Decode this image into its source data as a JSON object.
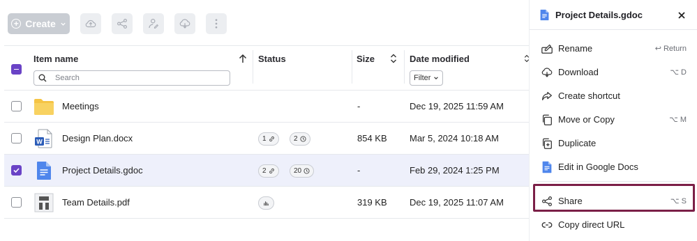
{
  "toolbar": {
    "create_label": "Create",
    "buttons": [
      "upload-icon",
      "share-icon",
      "assign-icon",
      "download-icon",
      "more-icon"
    ]
  },
  "table": {
    "headers": {
      "name": "Item name",
      "status": "Status",
      "size": "Size",
      "date": "Date modified"
    },
    "search_placeholder": "Search",
    "filter_label": "Filter",
    "rows": [
      {
        "name": "Meetings",
        "type": "folder",
        "status": [],
        "size": "-",
        "date": "Dec 19, 2025 11:59 AM",
        "selected": false
      },
      {
        "name": "Design Plan.docx",
        "type": "word",
        "status": [
          {
            "count": "1",
            "icon": "link-icon"
          },
          {
            "count": "2",
            "icon": "clock-icon"
          }
        ],
        "size": "854 KB",
        "date": "Mar 5, 2024 10:18 AM",
        "selected": false
      },
      {
        "name": "Project Details.gdoc",
        "type": "gdoc",
        "status": [
          {
            "count": "2",
            "icon": "link-icon"
          },
          {
            "count": "20",
            "icon": "clock-icon"
          }
        ],
        "size": "-",
        "date": "Feb 29, 2024 1:25 PM",
        "selected": true
      },
      {
        "name": "Team Details.pdf",
        "type": "pdf",
        "status": [
          {
            "count": "",
            "icon": "chart-icon"
          }
        ],
        "size": "319 KB",
        "date": "Dec 19, 2025 11:07 AM",
        "selected": false
      }
    ]
  },
  "panel": {
    "title": "Project Details.gdoc",
    "items": [
      {
        "label": "Rename",
        "shortcut": "↩ Return",
        "icon": "rename-icon"
      },
      {
        "label": "Download",
        "shortcut": "⌥ D",
        "icon": "download-icon"
      },
      {
        "label": "Create shortcut",
        "shortcut": "",
        "icon": "shortcut-icon"
      },
      {
        "label": "Move or Copy",
        "shortcut": "⌥ M",
        "icon": "move-copy-icon"
      },
      {
        "label": "Duplicate",
        "shortcut": "",
        "icon": "duplicate-icon"
      },
      {
        "label": "Edit in Google Docs",
        "shortcut": "",
        "icon": "google-docs-icon"
      },
      {
        "label": "Share",
        "shortcut": "⌥ S",
        "icon": "share-icon"
      },
      {
        "label": "Copy direct URL",
        "shortcut": "",
        "icon": "link-icon"
      }
    ]
  },
  "colors": {
    "accent": "#6a43c6",
    "highlight_border": "#7b1f47",
    "selected_row": "#eef0fb",
    "create_disabled": "#c9cdd3"
  }
}
